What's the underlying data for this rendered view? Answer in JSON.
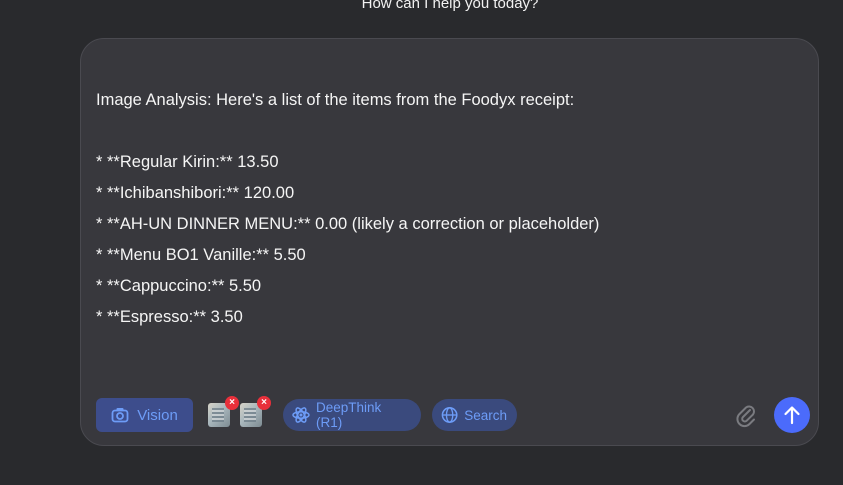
{
  "header": {
    "prompt": "How can I help you today?"
  },
  "composer": {
    "lines": [
      "Image Analysis: Here's a list of the items from the Foodyx receipt:",
      "",
      "* **Regular Kirin:** 13.50",
      "* **Ichibanshibori:** 120.00",
      "* **AH-UN DINNER MENU:** 0.00 (likely a correction or placeholder)",
      "* **Menu BO1 Vanille:** 5.50",
      "* **Cappuccino:** 5.50",
      "* **Espresso:** 3.50"
    ]
  },
  "toolbar": {
    "vision_label": "Vision",
    "vision_icon": "camera-icon",
    "attachments": [
      {
        "icon": "image-thumbnail",
        "remove_icon": "remove-x-icon",
        "remove_glyph": "×"
      },
      {
        "icon": "image-thumbnail",
        "remove_icon": "remove-x-icon",
        "remove_glyph": "×"
      }
    ],
    "deepthink_label": "DeepThink (R1)",
    "deepthink_icon": "atom-icon",
    "search_label": "Search",
    "search_icon": "globe-icon",
    "attach_icon": "paperclip-icon",
    "send_icon": "arrow-up-icon"
  },
  "colors": {
    "background": "#292a2d",
    "composer": "#38383d",
    "accent": "#6d9cf7",
    "send": "#4b6bfb",
    "remove": "#e8303b"
  }
}
